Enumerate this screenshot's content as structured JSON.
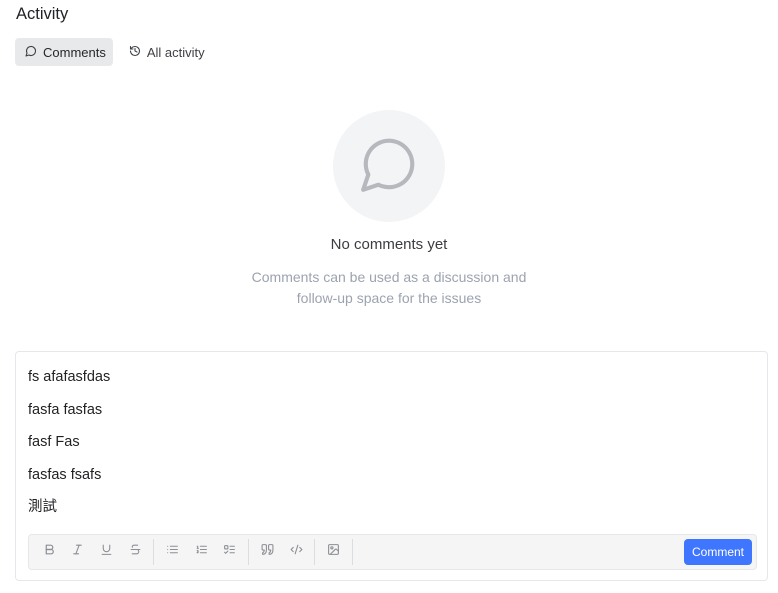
{
  "header": {
    "title": "Activity"
  },
  "tabs": [
    {
      "label": "Comments",
      "icon": "message-circle-icon",
      "active": true
    },
    {
      "label": "All activity",
      "icon": "history-icon",
      "active": false
    }
  ],
  "empty_state": {
    "icon": "message-circle-icon",
    "title": "No comments yet",
    "description_line1": "Comments can be used as a discussion and",
    "description_line2": "follow-up space for the issues"
  },
  "editor": {
    "lines": [
      "fs afafasfdas",
      "fasfa fasfas",
      "fasf Fas",
      "fasfas fsafs",
      "測試"
    ],
    "toolbar": {
      "groups": [
        [
          "bold-icon",
          "italic-icon",
          "underline-icon",
          "strikethrough-icon"
        ],
        [
          "bullet-list-icon",
          "numbered-list-icon",
          "task-list-icon"
        ],
        [
          "quote-icon",
          "code-icon"
        ],
        [
          "image-icon"
        ]
      ]
    },
    "submit_label": "Comment"
  },
  "colors": {
    "accent": "#3f76ff",
    "toolbar_bg": "#f5f5f5",
    "muted_text": "#9ca3af",
    "tab_active_bg": "#e8e9eb"
  }
}
